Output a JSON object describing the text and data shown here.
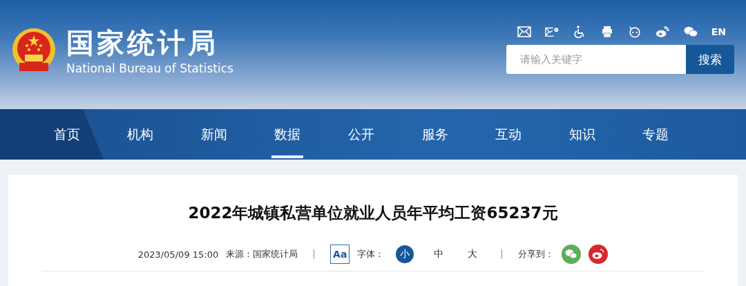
{
  "site": {
    "title": "国家统计局",
    "subtitle": "National Bureau of Statistics"
  },
  "language": "EN",
  "search": {
    "placeholder": "请输入关键字",
    "button": "搜索"
  },
  "nav": [
    {
      "label": "首页",
      "kind": "home",
      "selected": false
    },
    {
      "label": "机构",
      "kind": "link",
      "selected": false
    },
    {
      "label": "新闻",
      "kind": "link",
      "selected": false
    },
    {
      "label": "数据",
      "kind": "link",
      "selected": true
    },
    {
      "label": "公开",
      "kind": "link",
      "selected": false
    },
    {
      "label": "服务",
      "kind": "link",
      "selected": false
    },
    {
      "label": "互动",
      "kind": "link",
      "selected": false
    },
    {
      "label": "知识",
      "kind": "link",
      "selected": false
    },
    {
      "label": "专题",
      "kind": "link",
      "selected": false
    }
  ],
  "article": {
    "title": "2022年城镇私营单位就业人员年平均工资65237元",
    "date": "2023/05/09 15:00",
    "source": "来源：国家统计局",
    "font_button": "Aa",
    "font_label": "字体：",
    "font_sizes": [
      {
        "label": "小",
        "selected": true
      },
      {
        "label": "中",
        "selected": false
      },
      {
        "label": "大",
        "selected": false
      }
    ],
    "share_label": "分享到："
  }
}
